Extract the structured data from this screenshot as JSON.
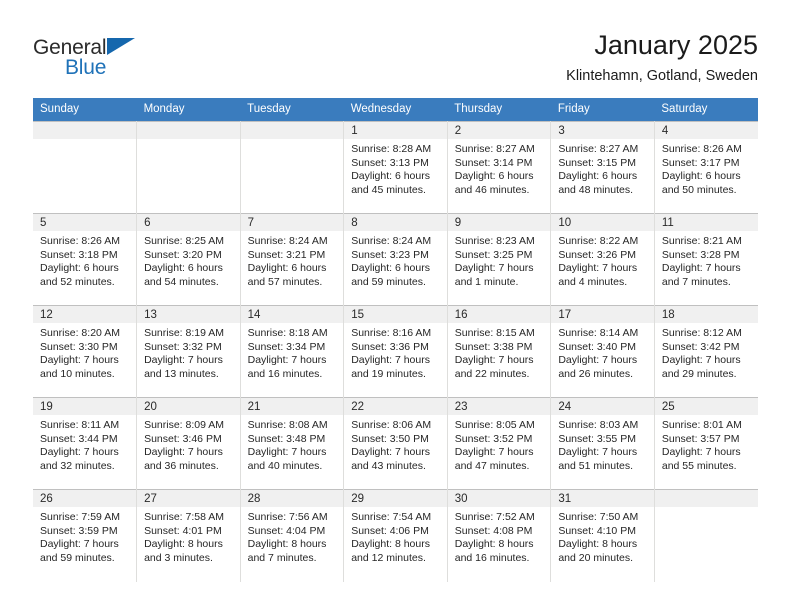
{
  "brand": {
    "line1": "General",
    "line2": "Blue",
    "triangle_color": "#1567ad",
    "blue_color": "#1f72b8"
  },
  "header": {
    "title": "January 2025",
    "location": "Klintehamn, Gotland, Sweden",
    "header_bg": "#3a7cbe",
    "daynum_bg": "#f0f0f0"
  },
  "weekday_headers": [
    "Sunday",
    "Monday",
    "Tuesday",
    "Wednesday",
    "Thursday",
    "Friday",
    "Saturday"
  ],
  "weeks": [
    [
      {
        "day": "",
        "lines": []
      },
      {
        "day": "",
        "lines": []
      },
      {
        "day": "",
        "lines": []
      },
      {
        "day": "1",
        "lines": [
          "Sunrise: 8:28 AM",
          "Sunset: 3:13 PM",
          "Daylight: 6 hours",
          "and 45 minutes."
        ]
      },
      {
        "day": "2",
        "lines": [
          "Sunrise: 8:27 AM",
          "Sunset: 3:14 PM",
          "Daylight: 6 hours",
          "and 46 minutes."
        ]
      },
      {
        "day": "3",
        "lines": [
          "Sunrise: 8:27 AM",
          "Sunset: 3:15 PM",
          "Daylight: 6 hours",
          "and 48 minutes."
        ]
      },
      {
        "day": "4",
        "lines": [
          "Sunrise: 8:26 AM",
          "Sunset: 3:17 PM",
          "Daylight: 6 hours",
          "and 50 minutes."
        ]
      }
    ],
    [
      {
        "day": "5",
        "lines": [
          "Sunrise: 8:26 AM",
          "Sunset: 3:18 PM",
          "Daylight: 6 hours",
          "and 52 minutes."
        ]
      },
      {
        "day": "6",
        "lines": [
          "Sunrise: 8:25 AM",
          "Sunset: 3:20 PM",
          "Daylight: 6 hours",
          "and 54 minutes."
        ]
      },
      {
        "day": "7",
        "lines": [
          "Sunrise: 8:24 AM",
          "Sunset: 3:21 PM",
          "Daylight: 6 hours",
          "and 57 minutes."
        ]
      },
      {
        "day": "8",
        "lines": [
          "Sunrise: 8:24 AM",
          "Sunset: 3:23 PM",
          "Daylight: 6 hours",
          "and 59 minutes."
        ]
      },
      {
        "day": "9",
        "lines": [
          "Sunrise: 8:23 AM",
          "Sunset: 3:25 PM",
          "Daylight: 7 hours",
          "and 1 minute."
        ]
      },
      {
        "day": "10",
        "lines": [
          "Sunrise: 8:22 AM",
          "Sunset: 3:26 PM",
          "Daylight: 7 hours",
          "and 4 minutes."
        ]
      },
      {
        "day": "11",
        "lines": [
          "Sunrise: 8:21 AM",
          "Sunset: 3:28 PM",
          "Daylight: 7 hours",
          "and 7 minutes."
        ]
      }
    ],
    [
      {
        "day": "12",
        "lines": [
          "Sunrise: 8:20 AM",
          "Sunset: 3:30 PM",
          "Daylight: 7 hours",
          "and 10 minutes."
        ]
      },
      {
        "day": "13",
        "lines": [
          "Sunrise: 8:19 AM",
          "Sunset: 3:32 PM",
          "Daylight: 7 hours",
          "and 13 minutes."
        ]
      },
      {
        "day": "14",
        "lines": [
          "Sunrise: 8:18 AM",
          "Sunset: 3:34 PM",
          "Daylight: 7 hours",
          "and 16 minutes."
        ]
      },
      {
        "day": "15",
        "lines": [
          "Sunrise: 8:16 AM",
          "Sunset: 3:36 PM",
          "Daylight: 7 hours",
          "and 19 minutes."
        ]
      },
      {
        "day": "16",
        "lines": [
          "Sunrise: 8:15 AM",
          "Sunset: 3:38 PM",
          "Daylight: 7 hours",
          "and 22 minutes."
        ]
      },
      {
        "day": "17",
        "lines": [
          "Sunrise: 8:14 AM",
          "Sunset: 3:40 PM",
          "Daylight: 7 hours",
          "and 26 minutes."
        ]
      },
      {
        "day": "18",
        "lines": [
          "Sunrise: 8:12 AM",
          "Sunset: 3:42 PM",
          "Daylight: 7 hours",
          "and 29 minutes."
        ]
      }
    ],
    [
      {
        "day": "19",
        "lines": [
          "Sunrise: 8:11 AM",
          "Sunset: 3:44 PM",
          "Daylight: 7 hours",
          "and 32 minutes."
        ]
      },
      {
        "day": "20",
        "lines": [
          "Sunrise: 8:09 AM",
          "Sunset: 3:46 PM",
          "Daylight: 7 hours",
          "and 36 minutes."
        ]
      },
      {
        "day": "21",
        "lines": [
          "Sunrise: 8:08 AM",
          "Sunset: 3:48 PM",
          "Daylight: 7 hours",
          "and 40 minutes."
        ]
      },
      {
        "day": "22",
        "lines": [
          "Sunrise: 8:06 AM",
          "Sunset: 3:50 PM",
          "Daylight: 7 hours",
          "and 43 minutes."
        ]
      },
      {
        "day": "23",
        "lines": [
          "Sunrise: 8:05 AM",
          "Sunset: 3:52 PM",
          "Daylight: 7 hours",
          "and 47 minutes."
        ]
      },
      {
        "day": "24",
        "lines": [
          "Sunrise: 8:03 AM",
          "Sunset: 3:55 PM",
          "Daylight: 7 hours",
          "and 51 minutes."
        ]
      },
      {
        "day": "25",
        "lines": [
          "Sunrise: 8:01 AM",
          "Sunset: 3:57 PM",
          "Daylight: 7 hours",
          "and 55 minutes."
        ]
      }
    ],
    [
      {
        "day": "26",
        "lines": [
          "Sunrise: 7:59 AM",
          "Sunset: 3:59 PM",
          "Daylight: 7 hours",
          "and 59 minutes."
        ]
      },
      {
        "day": "27",
        "lines": [
          "Sunrise: 7:58 AM",
          "Sunset: 4:01 PM",
          "Daylight: 8 hours",
          "and 3 minutes."
        ]
      },
      {
        "day": "28",
        "lines": [
          "Sunrise: 7:56 AM",
          "Sunset: 4:04 PM",
          "Daylight: 8 hours",
          "and 7 minutes."
        ]
      },
      {
        "day": "29",
        "lines": [
          "Sunrise: 7:54 AM",
          "Sunset: 4:06 PM",
          "Daylight: 8 hours",
          "and 12 minutes."
        ]
      },
      {
        "day": "30",
        "lines": [
          "Sunrise: 7:52 AM",
          "Sunset: 4:08 PM",
          "Daylight: 8 hours",
          "and 16 minutes."
        ]
      },
      {
        "day": "31",
        "lines": [
          "Sunrise: 7:50 AM",
          "Sunset: 4:10 PM",
          "Daylight: 8 hours",
          "and 20 minutes."
        ]
      },
      {
        "day": "",
        "lines": []
      }
    ]
  ]
}
